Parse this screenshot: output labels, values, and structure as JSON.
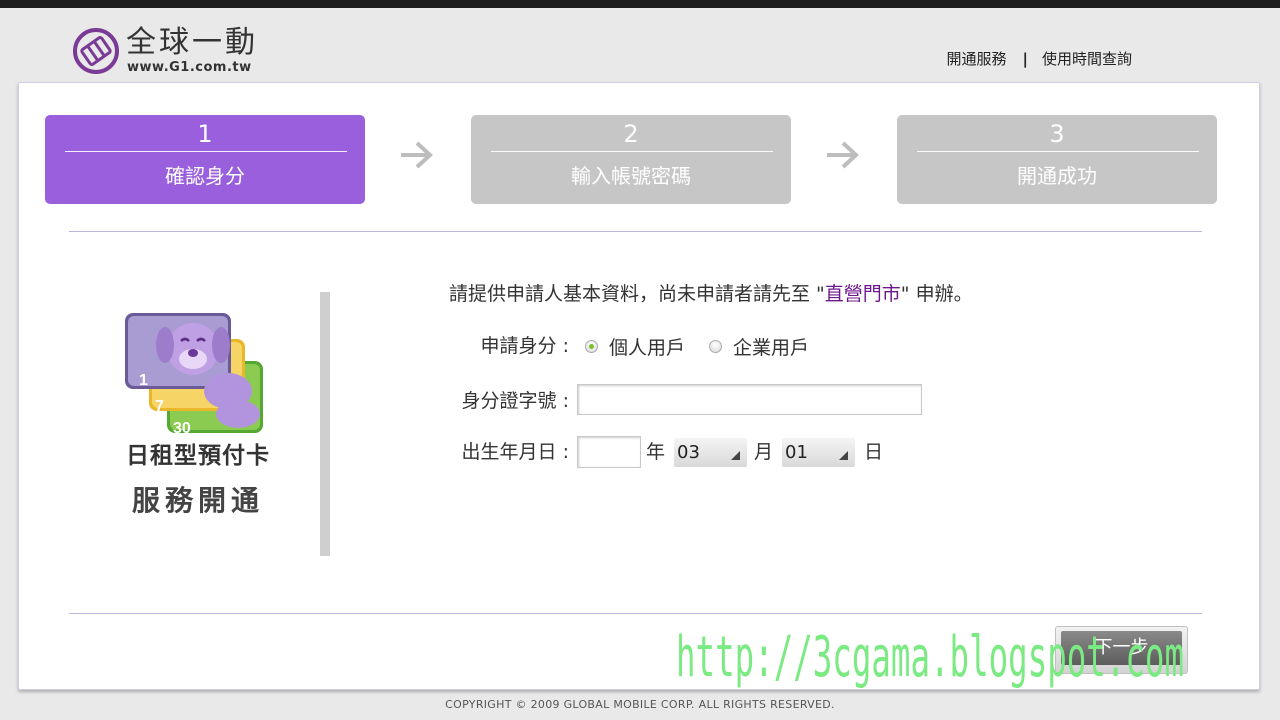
{
  "header": {
    "logo_cn": "全球一動",
    "logo_url": "www.G1.com.tw",
    "link_activate": "開通服務",
    "separator": "|",
    "link_usage": "使用時間查詢"
  },
  "steps": [
    {
      "number": "1",
      "label": "確認身分",
      "state": "active",
      "color": "#9a5fdc"
    },
    {
      "number": "2",
      "label": "輸入帳號密碼",
      "state": "inactive",
      "color": "#c6c6c6"
    },
    {
      "number": "3",
      "label": "開通成功",
      "state": "inactive",
      "color": "#c6c6c6"
    }
  ],
  "card": {
    "numbers": [
      "1",
      "7",
      "30"
    ],
    "title": "日租型預付卡",
    "subtitle": "服務開通"
  },
  "form": {
    "intro_before": "請提供申請人基本資料，尚未申請者請先至 \"",
    "intro_link": "直營門市",
    "intro_after": "\" 申辦。",
    "identity_label": "申請身分 :",
    "identity_options": [
      {
        "label": "個人用戶",
        "selected": true
      },
      {
        "label": "企業用戶",
        "selected": false
      }
    ],
    "id_label": "身分證字號 :",
    "id_value": "",
    "birth_label": "出生年月日 :",
    "year_value": "",
    "year_unit": "年",
    "month_value": "03",
    "month_unit": "月",
    "day_value": "01",
    "day_unit": "日"
  },
  "next_button": "下一步",
  "copyright": "COPYRIGHT © 2009 GLOBAL MOBILE CORP. ALL RIGHTS RESERVED.",
  "watermark": "http://3cgama.blogspot.com",
  "colors": {
    "accent": "#9a5fdc",
    "inactive_step": "#c6c6c6",
    "link": "#6c178e",
    "watermark": "#7bea82"
  }
}
